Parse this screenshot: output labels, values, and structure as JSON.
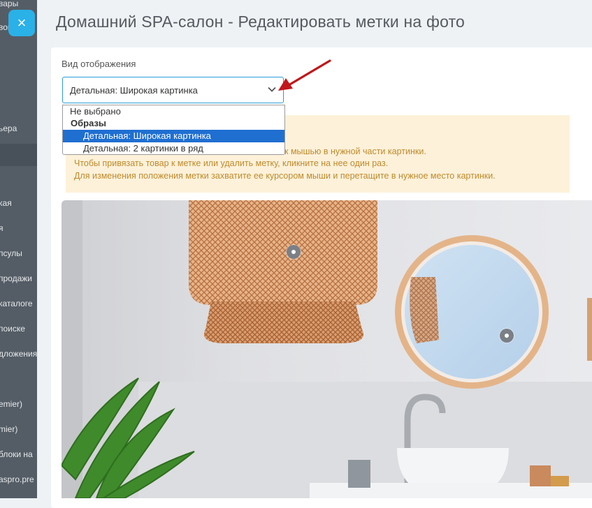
{
  "sidebar": {
    "items": [
      "вары",
      "вов",
      "ьера",
      "кая",
      "я",
      "псулы",
      "продажи",
      "каталоге",
      "поиске",
      "дложения",
      "emier)",
      "mier)",
      "блоки на",
      "aspro.pre"
    ]
  },
  "close_icon": "×",
  "title": "Домашний SPA-салон - Редактировать метки на фото",
  "form": {
    "label": "Вид отображения",
    "select_value": "Детальная: Широкая картинка"
  },
  "dropdown": {
    "options": [
      {
        "label": "Не выбрано",
        "type": "option"
      },
      {
        "label": "Образы",
        "type": "group"
      },
      {
        "label": "Детальная: Широкая картинка",
        "type": "option",
        "selected": true
      },
      {
        "label": "Детальная: 2 картинки в ряд",
        "type": "option"
      }
    ]
  },
  "notice": {
    "lines": [
      "к мышью в нужной части картинки.",
      "Чтобы привязать товар к метке или удалить метку, кликните на нее один раз.",
      "Для изменения положения метки захватите ее курсором мыши и перетащите в нужное место картинки."
    ]
  },
  "colors": {
    "sidebar": "#545d66",
    "accent": "#2ab1e8",
    "selected_option": "#1f6fd1",
    "notice_bg": "#fdf1d9",
    "notice_text": "#bf8a2c",
    "arrow": "#c0171b"
  },
  "photo": {
    "markers": 2
  }
}
